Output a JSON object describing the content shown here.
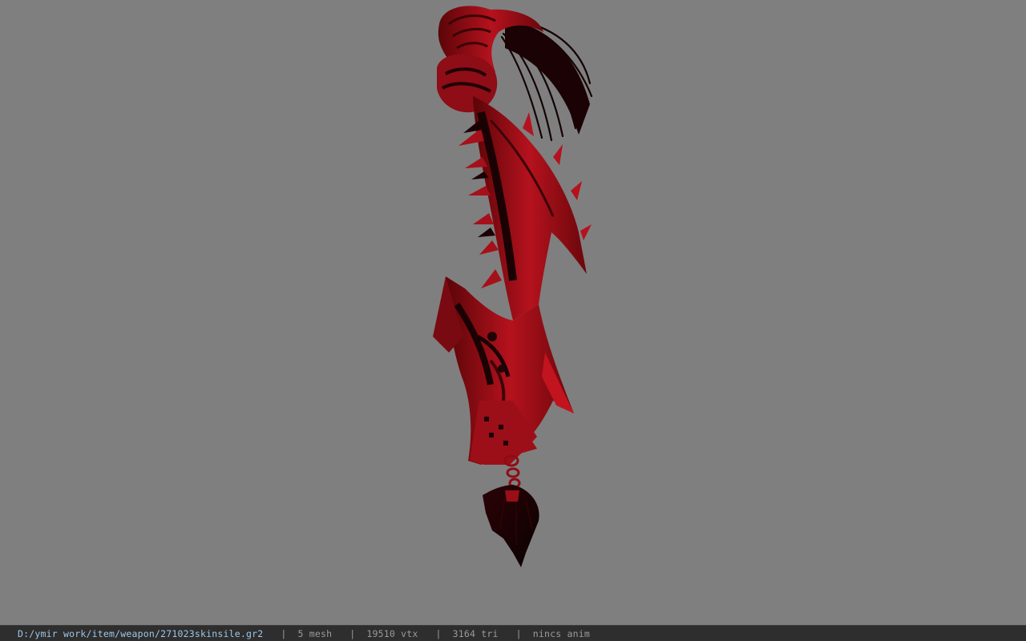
{
  "viewer": {
    "background_color": "#808080",
    "model_primary_color": "#a8101a",
    "model_shadow_color": "#1a0204",
    "model_highlight_color": "#d52030"
  },
  "statusbar": {
    "file_path": "D:/ymir work/item/weapon/271023skinsile.gr2",
    "separator": "|",
    "mesh_count": "5 mesh",
    "vertex_count": "19510 vtx",
    "triangle_count": "3164 tri",
    "animation": "nincs anim",
    "path_color": "#9fc6e8",
    "text_color": "#9a9a9a",
    "background_color": "#2e2e2e"
  }
}
